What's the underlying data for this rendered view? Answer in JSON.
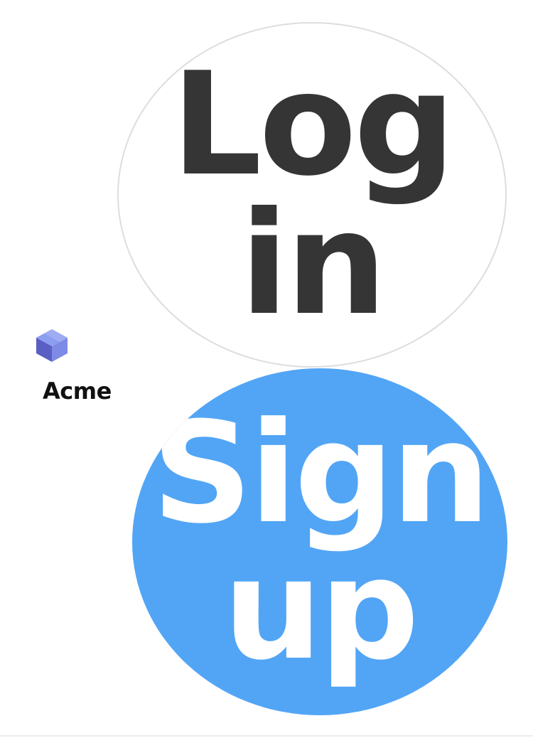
{
  "brand": {
    "logo_icon": "cube-icon",
    "name": "Acme"
  },
  "buttons": {
    "login": {
      "label_line1": "Log",
      "label_line2": "in"
    },
    "signup": {
      "label_line1": "Sign",
      "label_line2": "up"
    }
  },
  "colors": {
    "background": "#ffffff",
    "signup_fill": "#52a5f5",
    "login_text": "#353535",
    "login_border": "#dddddd",
    "cube_top": "#8c9ef0",
    "cube_left": "#5a5fc4",
    "cube_right": "#7d8be6",
    "brand_text": "#111111"
  }
}
